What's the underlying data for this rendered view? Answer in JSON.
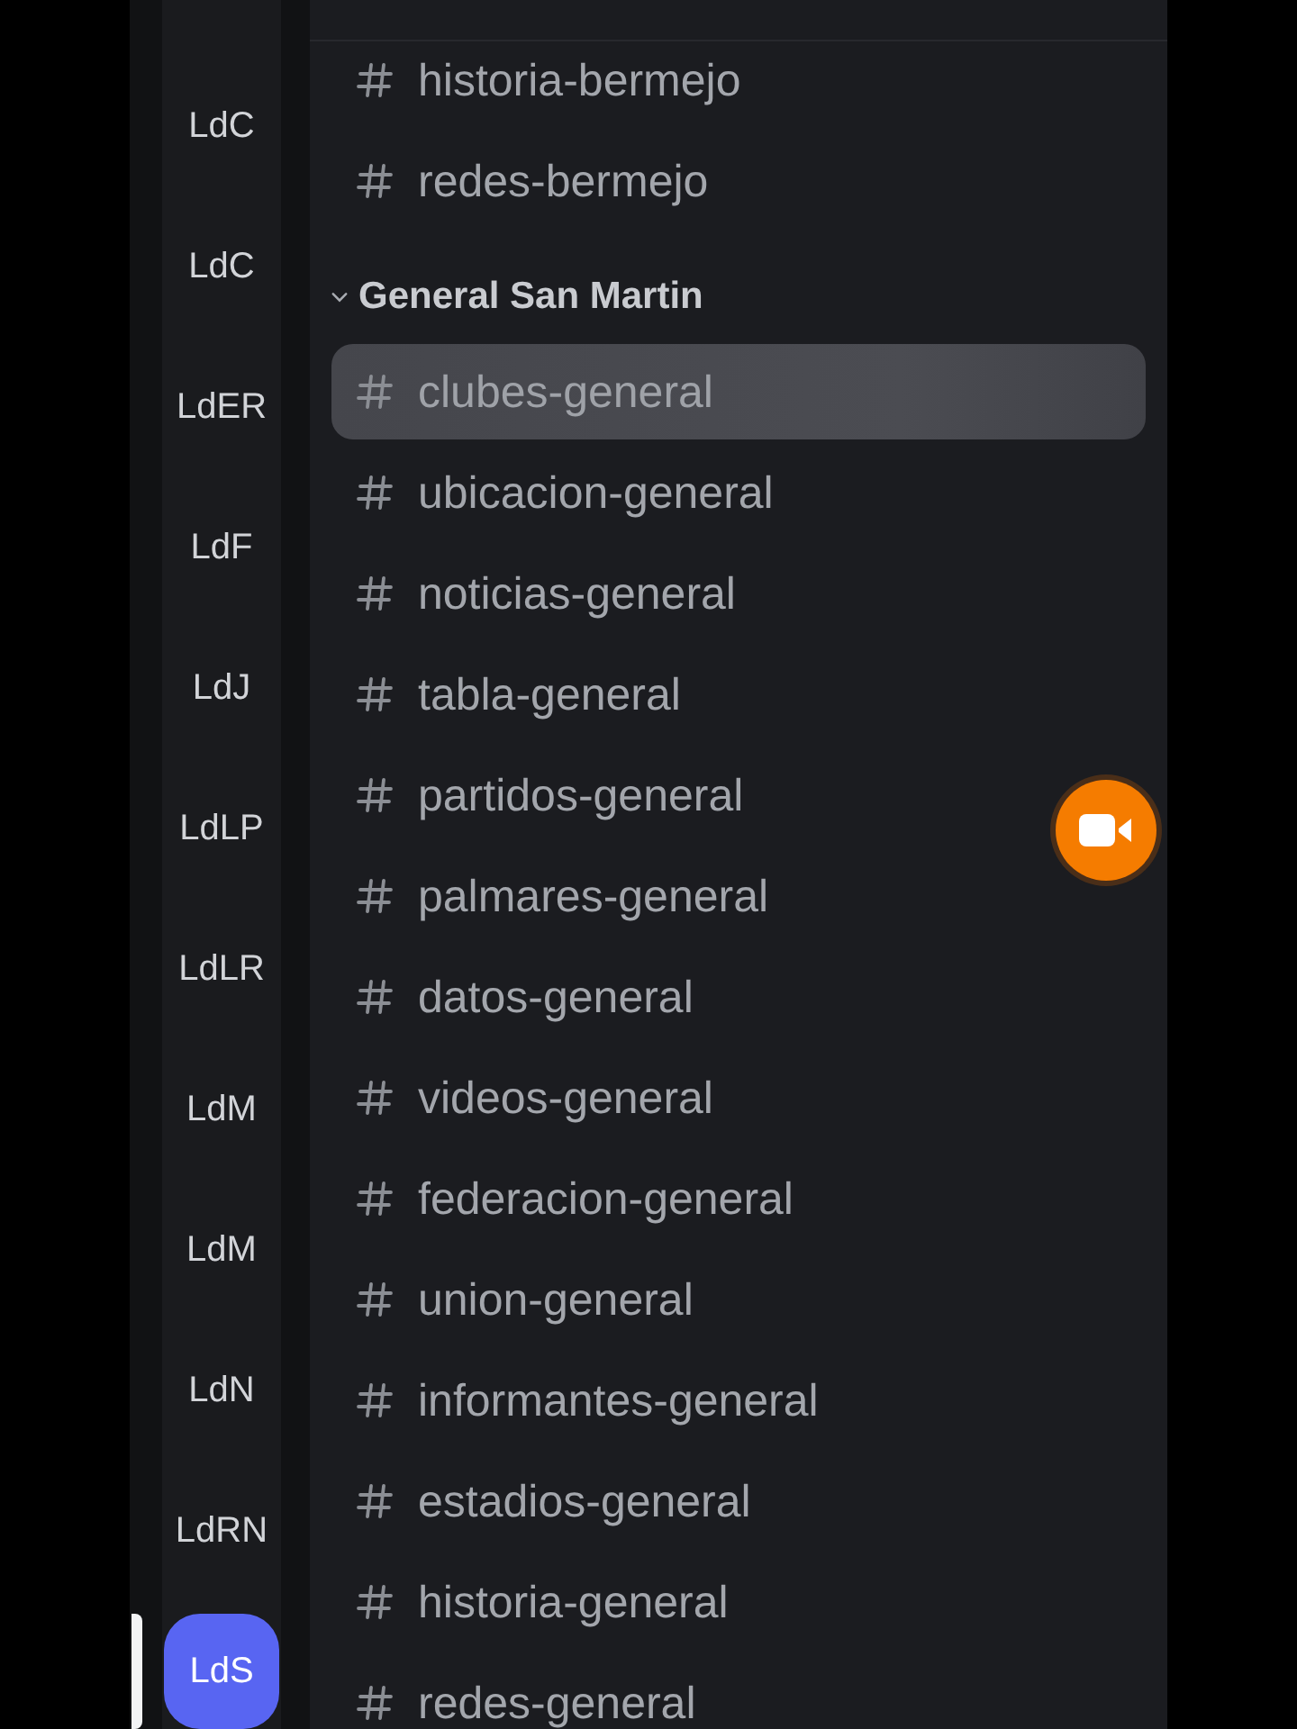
{
  "server_rail": {
    "servers": [
      {
        "label": "LdC",
        "selected": false
      },
      {
        "label": "LdC",
        "selected": false
      },
      {
        "label": "LdER",
        "selected": false
      },
      {
        "label": "LdF",
        "selected": false
      },
      {
        "label": "LdJ",
        "selected": false
      },
      {
        "label": "LdLP",
        "selected": false
      },
      {
        "label": "LdLR",
        "selected": false
      },
      {
        "label": "LdM",
        "selected": false
      },
      {
        "label": "LdM",
        "selected": false
      },
      {
        "label": "LdN",
        "selected": false
      },
      {
        "label": "LdRN",
        "selected": false
      },
      {
        "label": "LdS",
        "selected": true
      }
    ]
  },
  "channel_list": {
    "top_channels": [
      {
        "name": "historia-bermejo",
        "selected": false
      },
      {
        "name": "redes-bermejo",
        "selected": false
      }
    ],
    "categories": [
      {
        "name": "General San Martin",
        "expanded": true,
        "channels": [
          {
            "name": "clubes-general",
            "selected": true
          },
          {
            "name": "ubicacion-general",
            "selected": false
          },
          {
            "name": "noticias-general",
            "selected": false
          },
          {
            "name": "tabla-general",
            "selected": false
          },
          {
            "name": "partidos-general",
            "selected": false
          },
          {
            "name": "palmares-general",
            "selected": false
          },
          {
            "name": "datos-general",
            "selected": false
          },
          {
            "name": "videos-general",
            "selected": false
          },
          {
            "name": "federacion-general",
            "selected": false
          },
          {
            "name": "union-general",
            "selected": false
          },
          {
            "name": "informantes-general",
            "selected": false
          },
          {
            "name": "estadios-general",
            "selected": false
          },
          {
            "name": "historia-general",
            "selected": false
          },
          {
            "name": "redes-general",
            "selected": false
          }
        ]
      }
    ]
  }
}
